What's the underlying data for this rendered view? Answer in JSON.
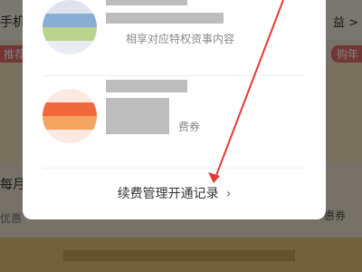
{
  "background": {
    "left_header": "手机",
    "right_header": "益 >",
    "left_pill": "推荐",
    "right_pill": "购年",
    "monthly": "每月",
    "discount": "优惠",
    "coupon": "惠券"
  },
  "modal": {
    "item_a": {
      "subtext": "相享对应特权资事内容"
    },
    "item_b": {
      "subtext": "费券"
    },
    "footer_link": "续费管理开通记录",
    "chevron": "›"
  }
}
